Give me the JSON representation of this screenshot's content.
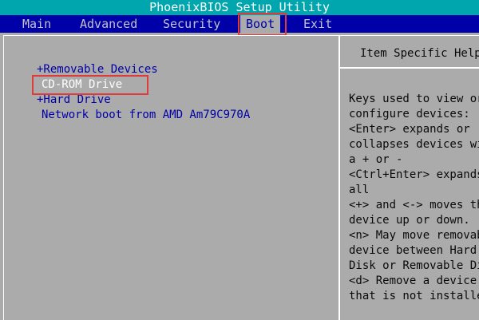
{
  "title": "PhoenixBIOS Setup Utility",
  "menu": [
    {
      "label": "Main"
    },
    {
      "label": "Advanced"
    },
    {
      "label": "Security"
    },
    {
      "label": "Boot"
    },
    {
      "label": "Exit"
    }
  ],
  "active_menu": "Boot",
  "boot_list": [
    {
      "label": "+Removable Devices",
      "selected": false
    },
    {
      "label": "CD-ROM Drive",
      "selected": true
    },
    {
      "label": "+Hard Drive",
      "selected": false
    },
    {
      "label": "Network boot from AMD Am79C970A",
      "selected": false
    }
  ],
  "help_panel": {
    "title": "Item Specific Help",
    "lines": [
      "Keys used to view or",
      "configure devices:",
      "<Enter> expands or",
      "collapses devices with",
      "a + or -",
      "<Ctrl+Enter> expands",
      "all",
      "<+> and <-> moves the",
      "device up or down.",
      "<n> May move removable",
      "device between Hard",
      "Disk or Removable Disk",
      "<d> Remove a device",
      "that is not installed."
    ]
  },
  "colors": {
    "title_bar": "#00a6ad",
    "menu_bar": "#0000a8",
    "background": "#ababab",
    "annotation": "#e03b3b"
  }
}
